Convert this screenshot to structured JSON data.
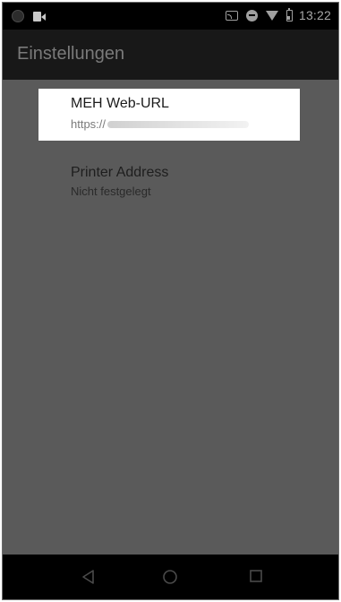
{
  "status_bar": {
    "time": "13:22",
    "left_icons": [
      "notification-dot-icon",
      "video-camera-icon"
    ],
    "right_icons": [
      "cast-icon",
      "do-not-disturb-icon",
      "wifi-icon",
      "battery-icon"
    ]
  },
  "app_bar": {
    "title": "Einstellungen"
  },
  "preferences": [
    {
      "title": "MEH Web-URL",
      "summary": "https://",
      "summary_redacted": true,
      "highlighted": true
    },
    {
      "title": "Printer Address",
      "summary": "Nicht festgelegt",
      "highlighted": false
    }
  ],
  "nav_bar": {
    "buttons": [
      "back-icon",
      "home-icon",
      "recents-icon"
    ]
  },
  "colors": {
    "status_bar_bg": "#000000",
    "app_bar_bg": "#181818",
    "content_bg": "#5a5a5a",
    "highlight_bg": "#ffffff",
    "nav_bar_bg": "#000000"
  }
}
